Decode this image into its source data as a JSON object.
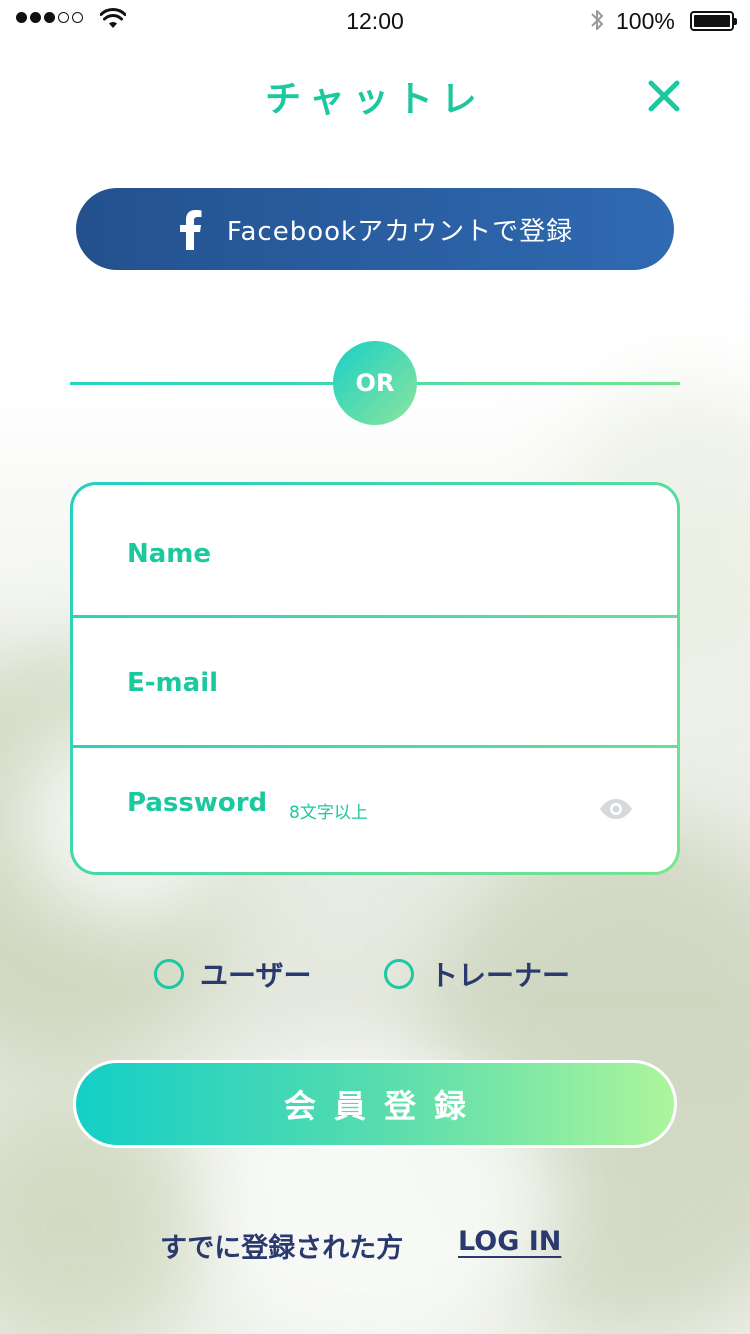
{
  "status_bar": {
    "time": "12:00",
    "battery_percent": "100%",
    "signal_bars_filled": 3,
    "signal_bars_total": 5
  },
  "header": {
    "title": "チャットレ"
  },
  "facebook": {
    "label": "Facebookアカウントで登録"
  },
  "divider": {
    "label": "OR"
  },
  "form": {
    "name_label": "Name",
    "email_label": "E-mail",
    "password_label": "Password",
    "password_hint": "8文字以上"
  },
  "role": {
    "user_label": "ユーザー",
    "trainer_label": "トレーナー"
  },
  "register": {
    "label": "会員登録"
  },
  "footer": {
    "already_text": "すでに登録された方",
    "login_label": "LOG IN"
  },
  "colors": {
    "accent": "#1cc8a0",
    "facebook": "#2a5ea2",
    "text_dark": "#2a3a6e"
  }
}
